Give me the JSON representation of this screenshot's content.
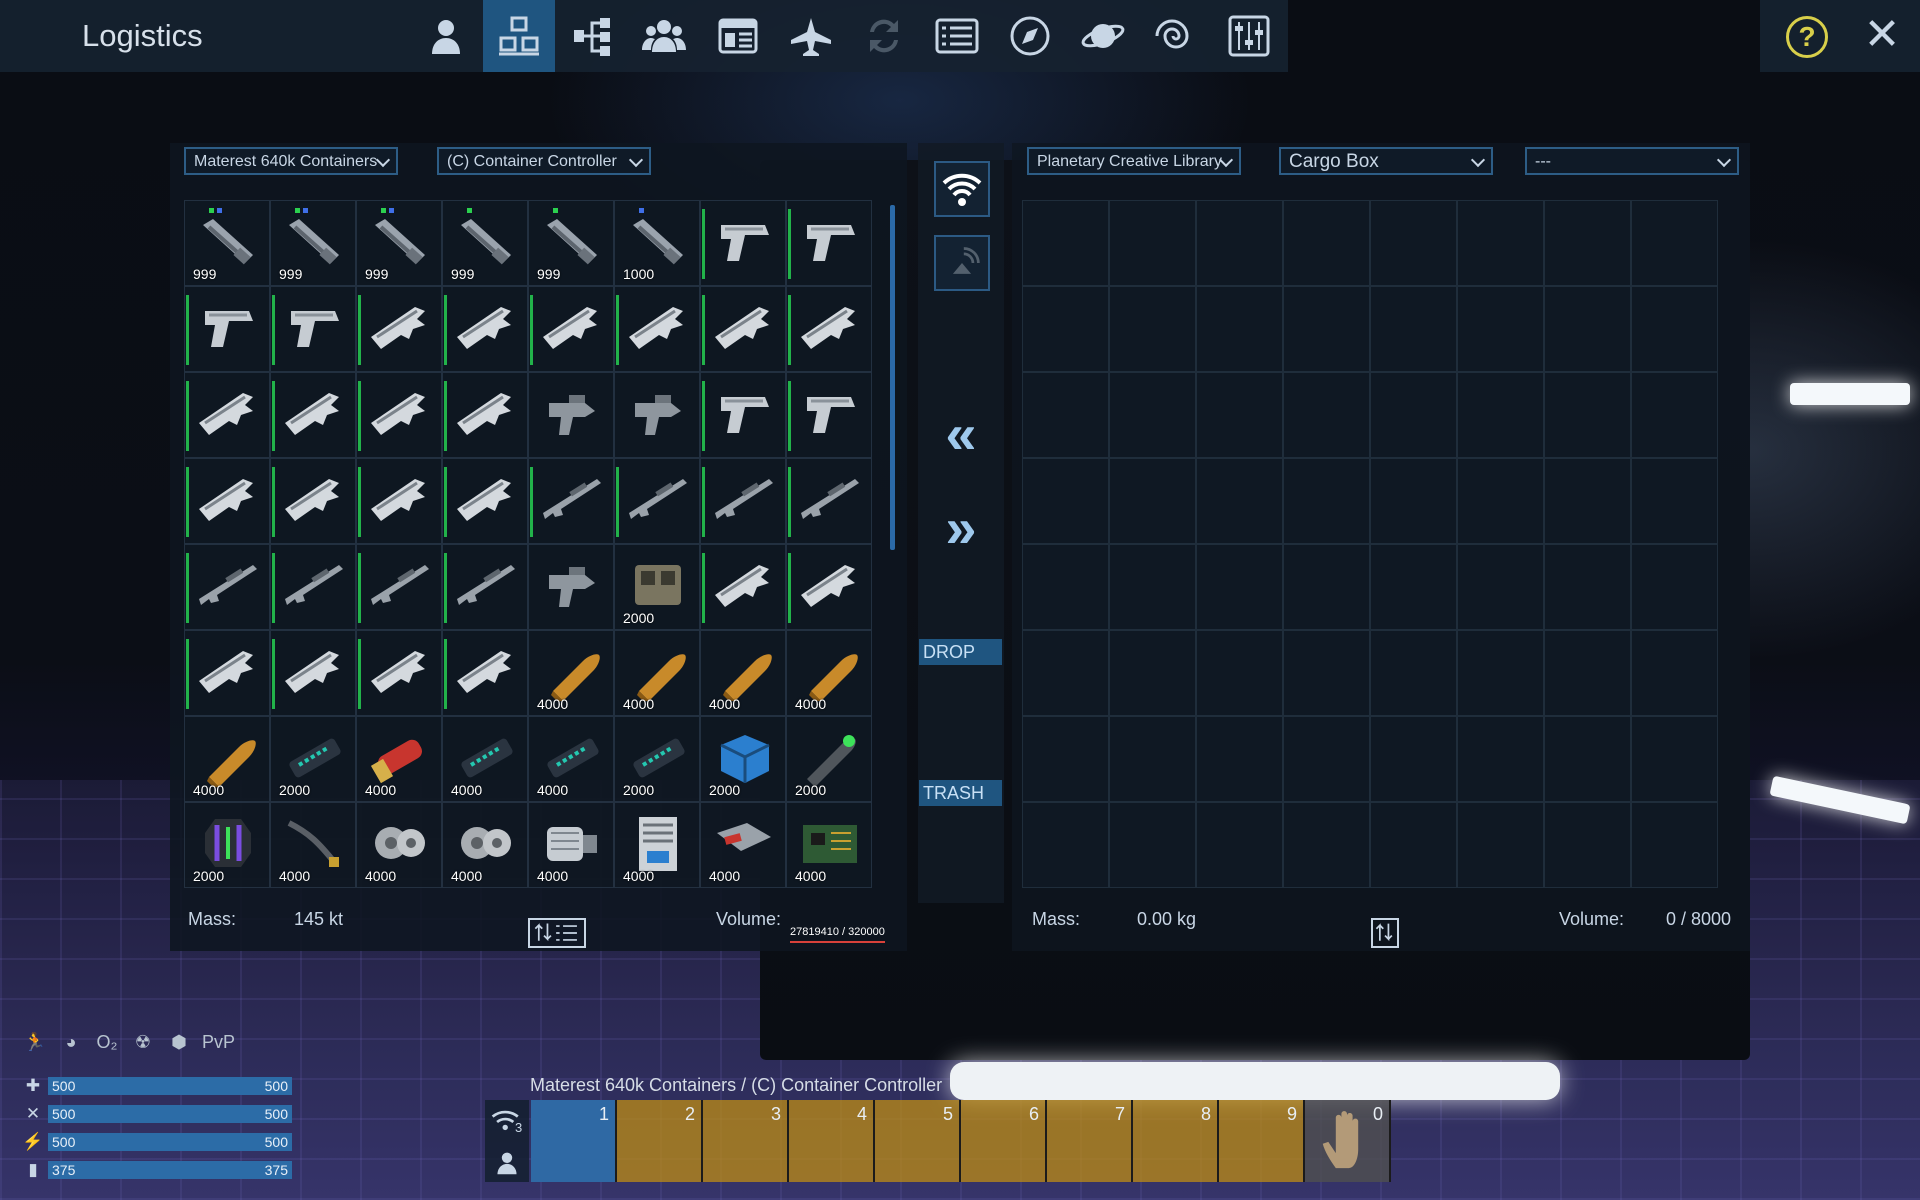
{
  "window": {
    "title": "Logistics"
  },
  "nav": {
    "items": [
      {
        "name": "player-icon"
      },
      {
        "name": "logistics-icon",
        "active": true
      },
      {
        "name": "techtree-icon"
      },
      {
        "name": "faction-icon"
      },
      {
        "name": "registry-icon"
      },
      {
        "name": "ship-icon"
      },
      {
        "name": "exchange-icon"
      },
      {
        "name": "list-icon"
      },
      {
        "name": "compass-icon"
      },
      {
        "name": "planet-icon"
      },
      {
        "name": "galaxy-icon"
      },
      {
        "name": "settings-sliders-icon"
      }
    ],
    "help_label": "?",
    "close_label": "✕"
  },
  "left": {
    "dropdown1": "Materest 640k Containers",
    "dropdown2": "(C) Container Controller",
    "items": [
      {
        "icon": "launcher",
        "count": "999",
        "dots": [
          "g",
          "b"
        ]
      },
      {
        "icon": "launcher",
        "count": "999",
        "dots": [
          "g",
          "b"
        ]
      },
      {
        "icon": "launcher",
        "count": "999",
        "dots": [
          "g",
          "b"
        ]
      },
      {
        "icon": "launcher",
        "count": "999",
        "dots": [
          "g"
        ]
      },
      {
        "icon": "launcher",
        "count": "999",
        "dots": [
          "g"
        ]
      },
      {
        "icon": "launcher",
        "count": "1000",
        "dots": [
          "b"
        ]
      },
      {
        "icon": "pistol",
        "count": "",
        "bar": true
      },
      {
        "icon": "pistol",
        "count": "",
        "bar": true
      },
      {
        "icon": "pistol",
        "count": "",
        "bar": true
      },
      {
        "icon": "pistol",
        "count": "",
        "bar": true
      },
      {
        "icon": "rifle",
        "count": "",
        "bar": true
      },
      {
        "icon": "rifle",
        "count": "",
        "bar": true
      },
      {
        "icon": "rifle",
        "count": "",
        "bar": true
      },
      {
        "icon": "rifle",
        "count": "",
        "bar": true
      },
      {
        "icon": "rifle",
        "count": "",
        "bar": true
      },
      {
        "icon": "rifle",
        "count": "",
        "bar": true
      },
      {
        "icon": "rifle",
        "count": "",
        "bar": true
      },
      {
        "icon": "rifle",
        "count": "",
        "bar": true
      },
      {
        "icon": "rifle",
        "count": "",
        "bar": true
      },
      {
        "icon": "rifle",
        "count": "",
        "bar": true
      },
      {
        "icon": "smg",
        "count": ""
      },
      {
        "icon": "smg",
        "count": ""
      },
      {
        "icon": "pistol",
        "count": "",
        "bar": true
      },
      {
        "icon": "pistol",
        "count": "",
        "bar": true
      },
      {
        "icon": "rifle",
        "count": "",
        "bar": true
      },
      {
        "icon": "rifle",
        "count": "",
        "bar": true
      },
      {
        "icon": "rifle",
        "count": "",
        "bar": true
      },
      {
        "icon": "rifle",
        "count": "",
        "bar": true
      },
      {
        "icon": "sniper",
        "count": "",
        "bar": true
      },
      {
        "icon": "sniper",
        "count": "",
        "bar": true
      },
      {
        "icon": "sniper",
        "count": "",
        "bar": true
      },
      {
        "icon": "sniper",
        "count": "",
        "bar": true
      },
      {
        "icon": "sniper",
        "count": "",
        "bar": true
      },
      {
        "icon": "sniper",
        "count": "",
        "bar": true
      },
      {
        "icon": "sniper",
        "count": "",
        "bar": true
      },
      {
        "icon": "sniper",
        "count": "",
        "bar": true
      },
      {
        "icon": "smg",
        "count": ""
      },
      {
        "icon": "module",
        "count": "2000"
      },
      {
        "icon": "rifle",
        "count": "",
        "bar": true
      },
      {
        "icon": "rifle",
        "count": "",
        "bar": true
      },
      {
        "icon": "rifle",
        "count": "",
        "bar": true
      },
      {
        "icon": "rifle",
        "count": "",
        "bar": true
      },
      {
        "icon": "rifle",
        "count": "",
        "bar": true
      },
      {
        "icon": "rifle",
        "count": "",
        "bar": true
      },
      {
        "icon": "bullet",
        "count": "4000"
      },
      {
        "icon": "bullet",
        "count": "4000"
      },
      {
        "icon": "bullet",
        "count": "4000"
      },
      {
        "icon": "bullet",
        "count": "4000"
      },
      {
        "icon": "bullet",
        "count": "4000"
      },
      {
        "icon": "cell",
        "count": "2000"
      },
      {
        "icon": "shell",
        "count": "4000"
      },
      {
        "icon": "cell",
        "count": "4000"
      },
      {
        "icon": "cell",
        "count": "4000"
      },
      {
        "icon": "cell",
        "count": "2000"
      },
      {
        "icon": "box",
        "count": "2000"
      },
      {
        "icon": "rocket",
        "count": "2000"
      },
      {
        "icon": "core",
        "count": "2000"
      },
      {
        "icon": "cable",
        "count": "4000"
      },
      {
        "icon": "gear",
        "count": "4000"
      },
      {
        "icon": "gear",
        "count": "4000"
      },
      {
        "icon": "motor",
        "count": "4000"
      },
      {
        "icon": "server",
        "count": "4000"
      },
      {
        "icon": "device",
        "count": "4000"
      },
      {
        "icon": "chip",
        "count": "4000"
      }
    ],
    "mass_label": "Mass:",
    "mass_value": "145 kt",
    "volume_label": "Volume:",
    "volume_value": "27819410 / 320000"
  },
  "right": {
    "dropdown1": "Planetary Creative Library",
    "dropdown2": "Cargo Box",
    "dropdown3": "---",
    "mass_label": "Mass:",
    "mass_value": "0.00 kg",
    "volume_label": "Volume:",
    "volume_value": "0 / 8000"
  },
  "middle": {
    "drop_label": "DROP",
    "trash_label": "TRASH",
    "arrow_left": "«",
    "arrow_right": "»"
  },
  "status": {
    "pvp_label": "PvP",
    "o2_label": "O₂",
    "bars": [
      {
        "icon": "health-icon",
        "glyph": "✚",
        "value": "500",
        "max": "500",
        "fraction": 1.0
      },
      {
        "icon": "food-icon",
        "glyph": "✕",
        "value": "500",
        "max": "500",
        "fraction": 1.0
      },
      {
        "icon": "stamina-icon",
        "glyph": "⚡",
        "value": "500",
        "max": "500",
        "fraction": 1.0
      },
      {
        "icon": "oxygen-icon",
        "glyph": "▮",
        "value": "375",
        "max": "375",
        "fraction": 1.0
      }
    ]
  },
  "hotbar": {
    "label": "Materest 640k Containers / (C) Container Controller",
    "signal_count": "3",
    "slots": [
      "1",
      "2",
      "3",
      "4",
      "5",
      "6",
      "7",
      "8",
      "9",
      "0"
    ]
  },
  "colors": {
    "accent": "#1f5580",
    "green": "#22b24a",
    "gold": "#be8c14"
  }
}
